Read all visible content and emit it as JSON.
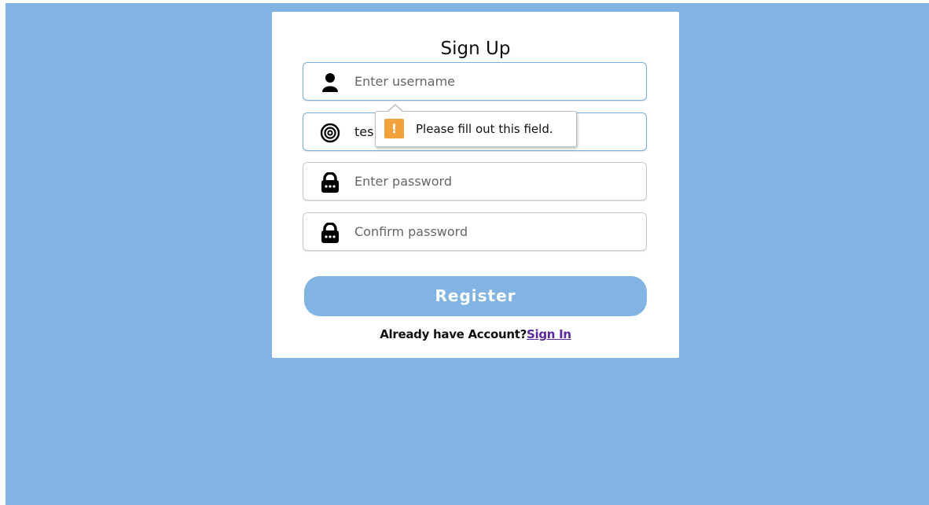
{
  "form": {
    "title": "Sign Up",
    "username": {
      "placeholder": "Enter username",
      "value": ""
    },
    "email": {
      "placeholder": "",
      "value": "tes"
    },
    "password": {
      "placeholder": "Enter password",
      "value": ""
    },
    "confirm_password": {
      "placeholder": "Confirm password",
      "value": ""
    },
    "register_label": "Register",
    "signin_prompt": "Already have Account?",
    "signin_link": "Sign In"
  },
  "tooltip": {
    "message": "Please fill out this field.",
    "icon": "!"
  },
  "icons": {
    "username": "user-icon",
    "email": "at-sign-icon",
    "password": "lock-icon",
    "confirm_password": "lock-icon",
    "tooltip": "warning-icon"
  },
  "colors": {
    "background": "#81b4e3",
    "button": "#81b4e3",
    "link": "#5a2a9d",
    "warning": "#f2a23a"
  }
}
